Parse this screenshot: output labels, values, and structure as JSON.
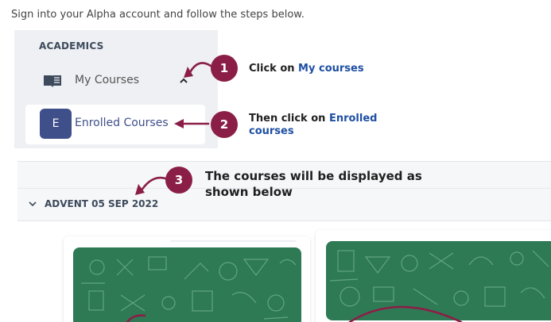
{
  "intro": {
    "text": "Sign into your Alpha account and follow the steps below."
  },
  "menu": {
    "heading": "ACADEMICS",
    "my_courses": {
      "label": "My Courses",
      "icon": "book-icon"
    },
    "enrolled_courses": {
      "label": "Enrolled Courses",
      "avatar_letter": "E",
      "avatar_color": "#3f4f8a"
    }
  },
  "steps": [
    {
      "number": "1",
      "text_prefix": "Click on ",
      "text_highlight": "My courses"
    },
    {
      "number": "2",
      "text_prefix": "Then click on ",
      "text_highlight": "Enrolled courses"
    },
    {
      "number": "3",
      "text": "The courses will be displayed as shown below"
    }
  ],
  "section": {
    "title": "ADVENT 05 SEP 2022"
  },
  "colors": {
    "accent": "#8b1e47",
    "link": "#1e4fa3",
    "card_green": "#2e7a55"
  }
}
